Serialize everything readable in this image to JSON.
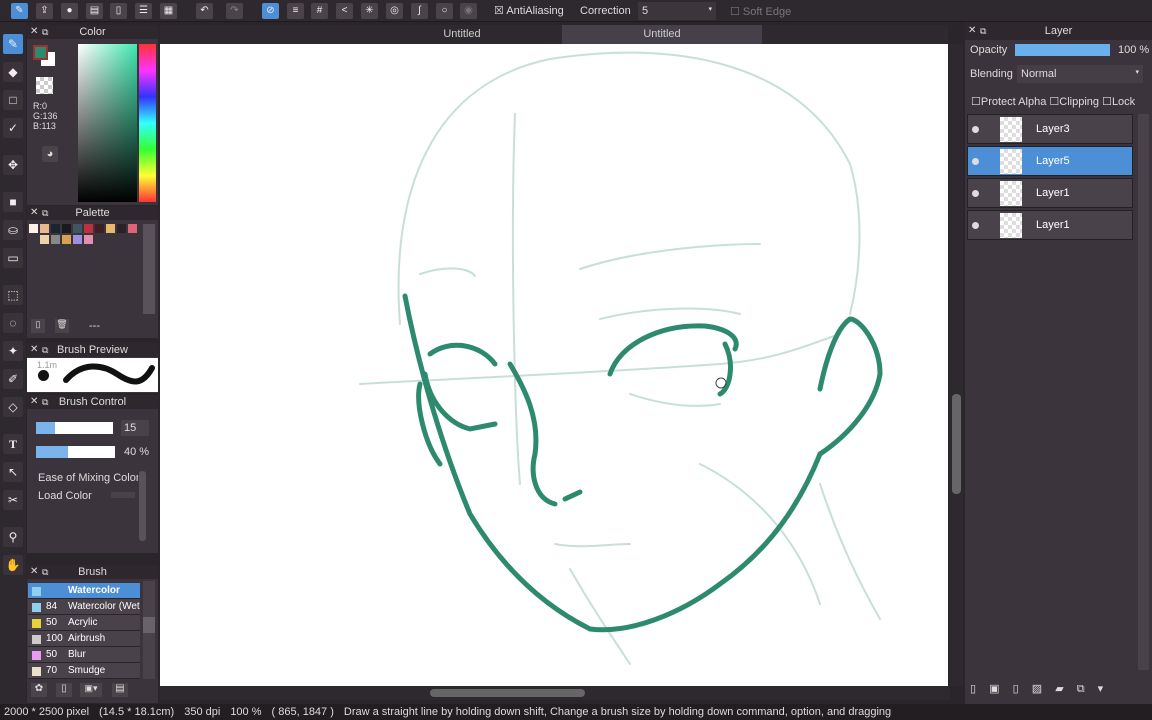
{
  "toolbar": {
    "antialiasing_label": "AntiAliasing",
    "correction_label": "Correction",
    "correction_value": "5",
    "soft_edge_label": "Soft Edge"
  },
  "tabs": [
    "Untitled",
    "Untitled"
  ],
  "color_panel": {
    "title": "Color",
    "r": "R:0",
    "g": "G:136",
    "b": "B:113",
    "main_color": "#008871"
  },
  "palette": {
    "title": "Palette",
    "dash": "---",
    "colors": [
      "#fdf2ea",
      "#e8b98f",
      "#1a2530",
      "#1a1a1e",
      "#3e5563",
      "#c0303a",
      "#3a1f25",
      "#e9b96a",
      "#2a2228",
      "#e06478",
      "#ecd3a8",
      "#888888",
      "#d9a050",
      "#9d8fe0",
      "#e58fb0"
    ]
  },
  "brush_preview": {
    "title": "Brush Preview",
    "size": "1.1m"
  },
  "brush_control": {
    "title": "Brush Control",
    "size": "15",
    "density": "40 %",
    "density_pct": 40,
    "size_pct": 25,
    "ease_label": "Ease of Mixing Color",
    "load_label": "Load Color"
  },
  "brush": {
    "title": "Brush",
    "items": [
      {
        "size": "",
        "name": "Watercolor",
        "color": "#8fd0ee",
        "selected": true
      },
      {
        "size": "84",
        "name": "Watercolor (Wet",
        "color": "#8fd0ee"
      },
      {
        "size": "50",
        "name": "Acrylic",
        "color": "#e6d23a"
      },
      {
        "size": "100",
        "name": "Airbrush",
        "color": "#d0cac8"
      },
      {
        "size": "50",
        "name": "Blur",
        "color": "#e79cf0"
      },
      {
        "size": "70",
        "name": "Smudge",
        "color": "#ede0c8"
      }
    ]
  },
  "layer_panel": {
    "title": "Layer",
    "opacity_label": "Opacity",
    "opacity": "100 %",
    "opacity_pct": 100,
    "blending_label": "Blending",
    "blending": "Normal",
    "protect_alpha": "Protect Alpha",
    "clipping": "Clipping",
    "lock": "Lock",
    "layers": [
      {
        "name": "Layer3"
      },
      {
        "name": "Layer5",
        "selected": true
      },
      {
        "name": "Layer1"
      },
      {
        "name": "Layer1"
      }
    ]
  },
  "status": {
    "size": "2000 * 2500 pixel",
    "physical": "(14.5 * 18.1cm)",
    "dpi": "350 dpi",
    "zoom": "100 %",
    "coords": "( 865, 1847 )",
    "hint": "Draw a straight line by holding down shift, Change a brush size by holding down command, option, and dragging"
  },
  "colors": {
    "accent": "#4d8fd6",
    "stroke": "#2e8a6e",
    "sketch": "#c5ddd6"
  }
}
